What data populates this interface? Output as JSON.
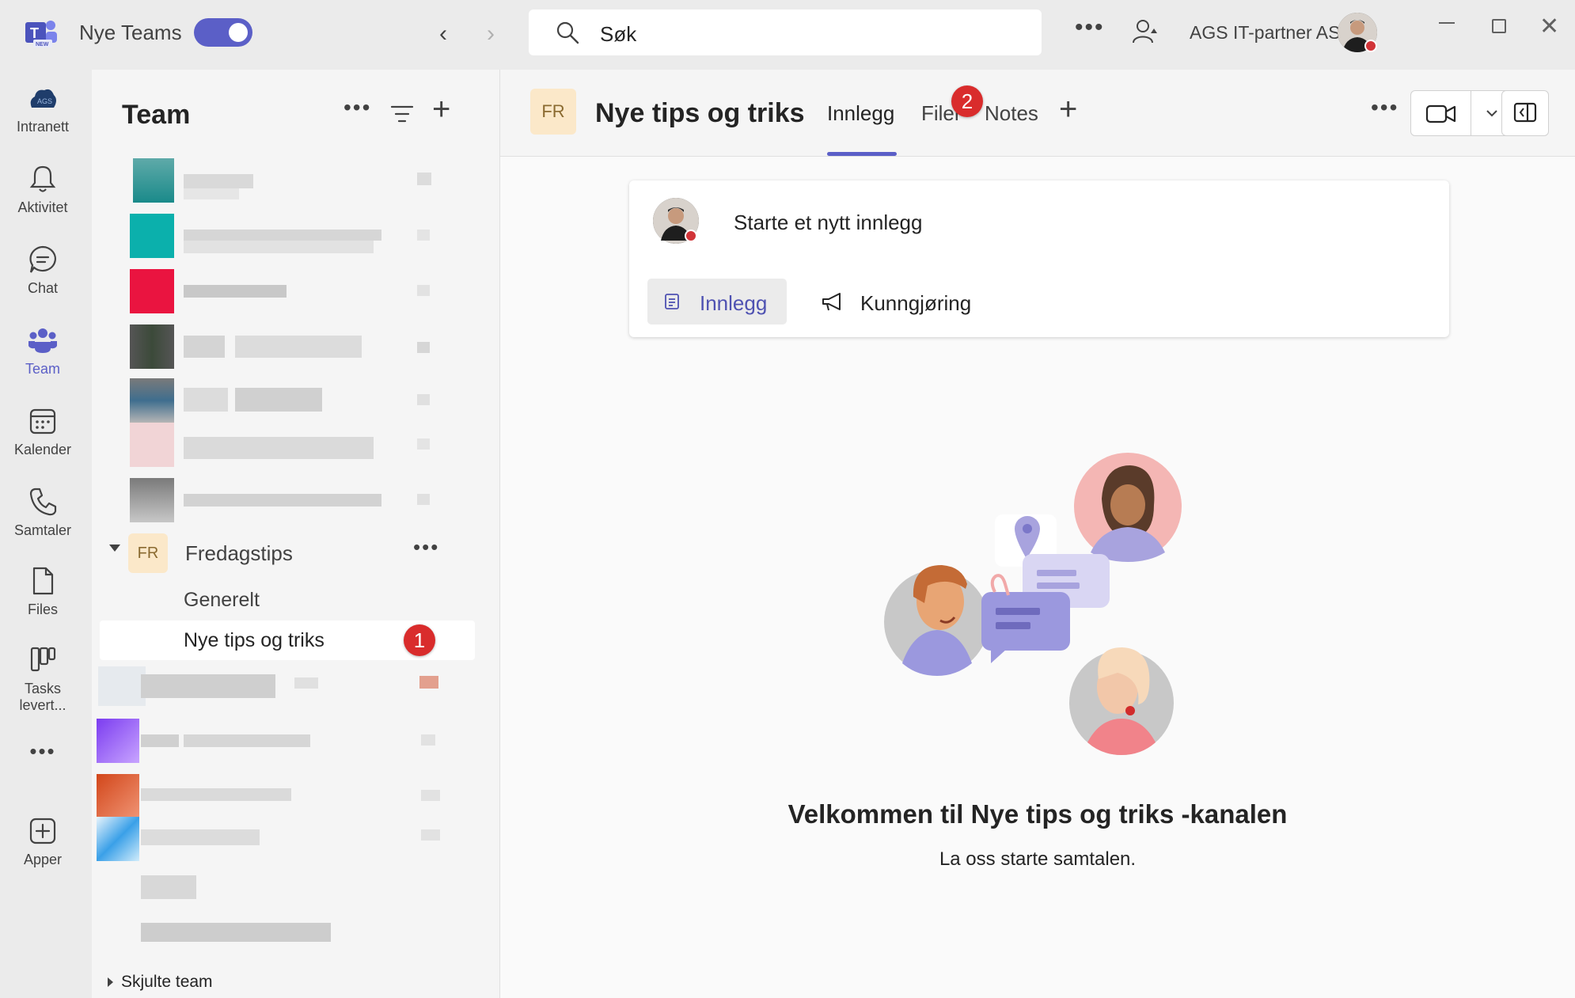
{
  "titlebar": {
    "app_title": "Nye Teams",
    "search_placeholder": "Søk",
    "org_name": "AGS IT-partner AS"
  },
  "rail": {
    "items": [
      {
        "label": "Intranett",
        "icon": "ags-logo-icon"
      },
      {
        "label": "Aktivitet",
        "icon": "bell-icon"
      },
      {
        "label": "Chat",
        "icon": "chat-icon"
      },
      {
        "label": "Team",
        "icon": "teams-icon",
        "active": true
      },
      {
        "label": "Kalender",
        "icon": "calendar-icon"
      },
      {
        "label": "Samtaler",
        "icon": "phone-icon"
      },
      {
        "label": "Files",
        "icon": "file-icon"
      },
      {
        "label": "Tasks levert...",
        "icon": "tasks-icon"
      },
      {
        "label": "Apper",
        "icon": "add-app-icon"
      }
    ]
  },
  "teams_panel": {
    "title": "Team",
    "team": {
      "initials": "FR",
      "name": "Fredagstips"
    },
    "channels": [
      "Generelt",
      "Nye tips og triks"
    ],
    "hidden_teams": "Skjulte team",
    "badge_1": "1"
  },
  "main": {
    "channel_initials": "FR",
    "channel_title": "Nye tips og triks",
    "tabs": [
      "Innlegg",
      "Filer",
      "Notes"
    ],
    "badge_2": "2",
    "composer": {
      "prompt": "Starte et nytt innlegg",
      "post_label": "Innlegg",
      "announce_label": "Kunngjøring"
    },
    "welcome_title": "Velkommen til Nye tips og triks -kanalen",
    "welcome_sub": "La oss starte samtalen."
  },
  "colors": {
    "accent": "#5b5fc7",
    "badge": "#d92c2c",
    "team_avatar_bg": "#fbe8c9"
  }
}
